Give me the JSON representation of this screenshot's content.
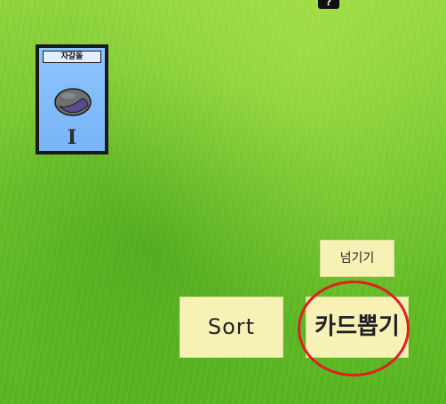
{
  "help_button": {
    "label": "?"
  },
  "card": {
    "name": "자갈돌",
    "level": "I",
    "colors": {
      "face": "#78b4f7",
      "border": "#1a1a1a",
      "stone": "#6d7070",
      "stone_shadow": "#5d4a8a"
    },
    "art_icon": "stone-icon"
  },
  "buttons": {
    "pass_label": "넘기기",
    "sort_label": "Sort",
    "draw_label": "카드뽑기"
  },
  "highlight": {
    "color": "#e01f1f",
    "target": "draw-card-button"
  }
}
